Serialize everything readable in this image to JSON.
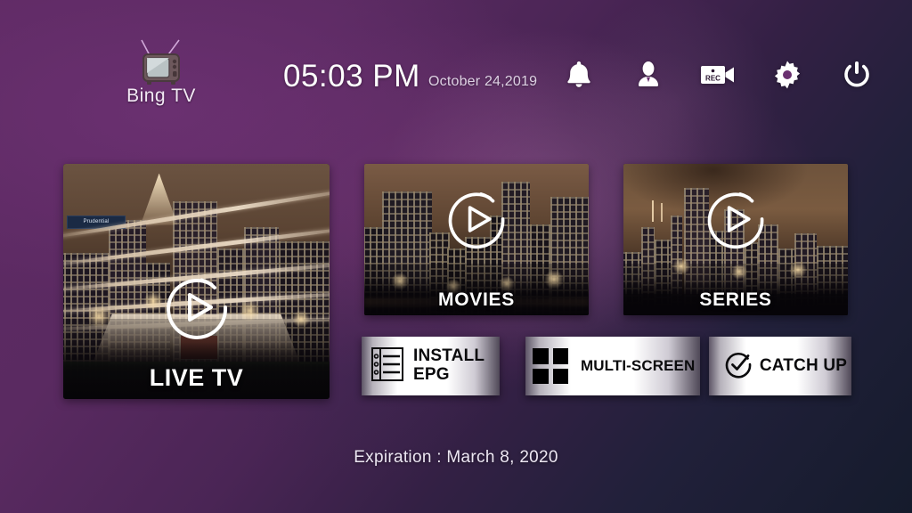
{
  "app": {
    "brand_name": "Bing TV",
    "brand_icon": "retro-tv-icon"
  },
  "header": {
    "clock": "05:03 PM",
    "date": "October 24,2019",
    "icons": [
      {
        "name": "bell-icon",
        "label": "Notifications"
      },
      {
        "name": "person-icon",
        "label": "Account"
      },
      {
        "name": "rec-camera-icon",
        "label": "REC",
        "badge_text": "REC"
      },
      {
        "name": "gear-icon",
        "label": "Settings"
      },
      {
        "name": "power-icon",
        "label": "Power"
      }
    ]
  },
  "tiles": [
    {
      "id": "live",
      "label": "LIVE TV",
      "play_icon": "play-circle-icon"
    },
    {
      "id": "movies",
      "label": "MOVIES",
      "play_icon": "play-circle-icon"
    },
    {
      "id": "series",
      "label": "SERIES",
      "play_icon": "play-circle-icon"
    }
  ],
  "tile_art": {
    "live_billboard": "Prudential"
  },
  "actions": [
    {
      "id": "epg",
      "label": "INSTALL\nEPG",
      "line1": "INSTALL",
      "line2": "EPG",
      "icon": "epg-list-icon"
    },
    {
      "id": "multiscreen",
      "label": "MULTI-SCREEN",
      "icon": "four-squares-icon"
    },
    {
      "id": "catchup",
      "label": "CATCH UP",
      "icon": "check-circle-clock-icon"
    }
  ],
  "footer": {
    "expiration": "Expiration : March 8, 2020"
  },
  "colors": {
    "background_start": "#5e2a63",
    "background_end": "#151b2c",
    "text_primary": "#ffffff",
    "text_secondary": "#ded2e4",
    "button_face": "#ffffff",
    "button_text": "#0b0b0d"
  }
}
